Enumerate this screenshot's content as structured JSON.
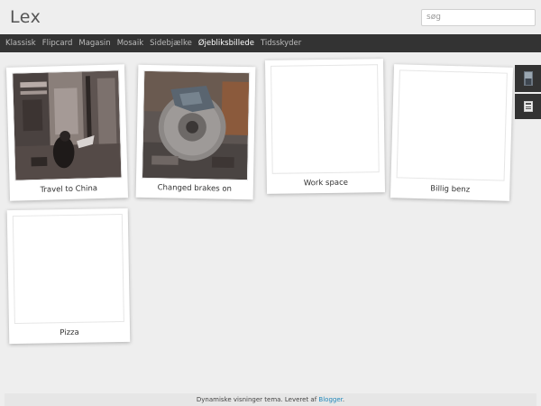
{
  "header": {
    "blog_title": "Lex",
    "search_placeholder": "søg"
  },
  "nav": {
    "items": [
      "Klassisk",
      "Flipcard",
      "Magasin",
      "Mosaik",
      "Sidebjælke",
      "Øjebliksbillede",
      "Tidsskyder"
    ],
    "active": "Øjebliksbillede"
  },
  "posts": [
    {
      "title": "Travel to China",
      "image": "airport-photo"
    },
    {
      "title": "Changed brakes on",
      "image": "brake-disc-photo"
    },
    {
      "title": "Work space",
      "image": ""
    },
    {
      "title": "Billig benz",
      "image": ""
    },
    {
      "title": "Pizza",
      "image": ""
    }
  ],
  "side_widgets": [
    "profile-thumbnail-icon",
    "archive-icon"
  ],
  "footer": {
    "text": "Dynamiske visninger tema. Leveret af ",
    "link": "Blogger",
    "suffix": "."
  },
  "colors": {
    "background": "#eeeeee",
    "navbar": "#333333",
    "nav_active": "#ffffff",
    "nav_inactive": "#bbbbbb",
    "link": "#2288bb"
  }
}
